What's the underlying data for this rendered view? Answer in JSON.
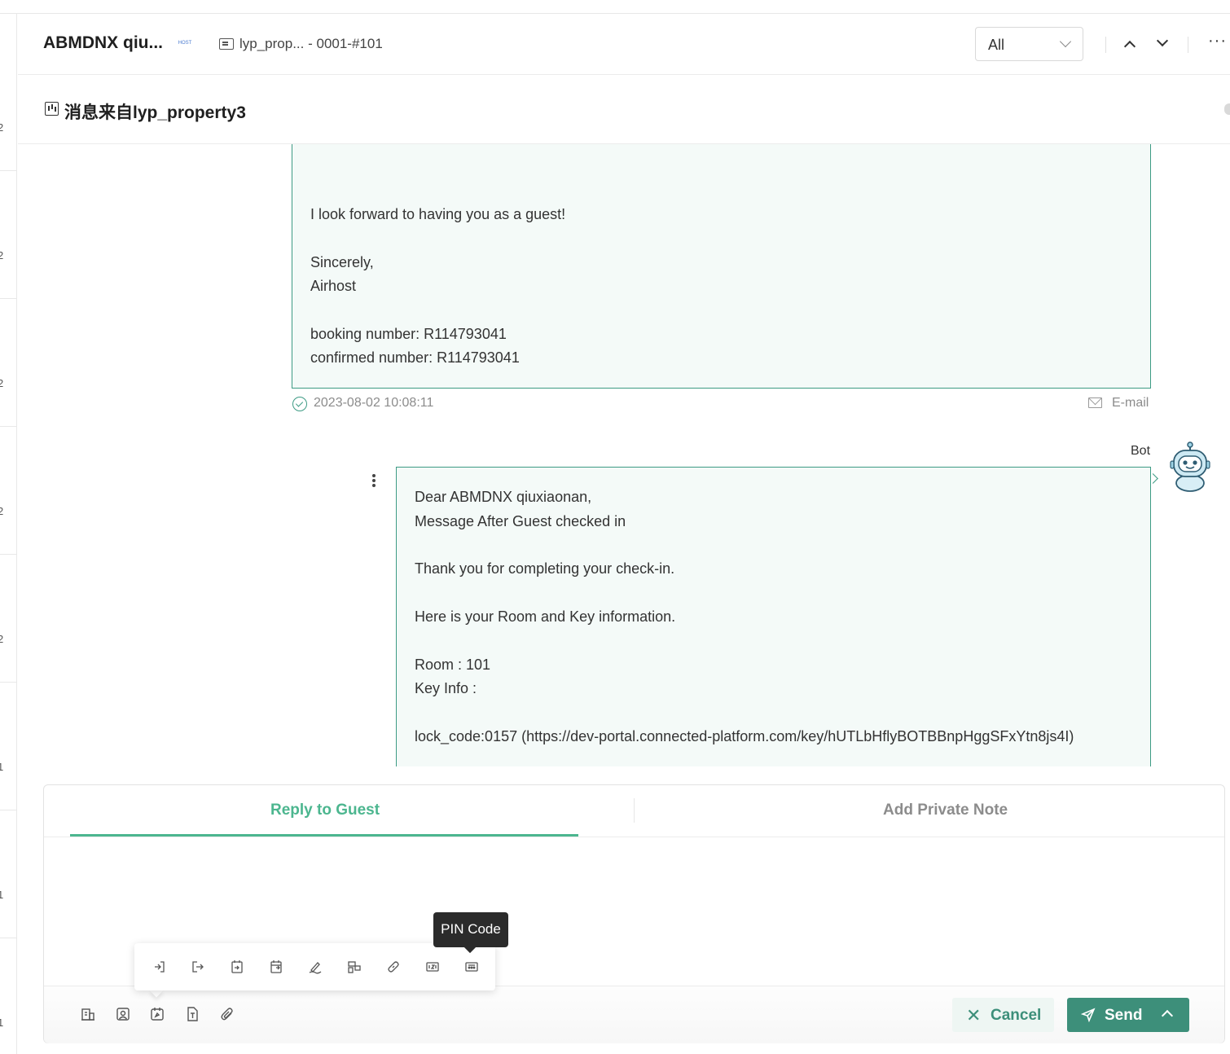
{
  "header": {
    "guest_name": "ABMDNX qiu...",
    "host_logo_text": "HOST",
    "property_label": "lyp_prop... - 0001-#101",
    "filter_select": "All",
    "more_label": "···"
  },
  "subheader": {
    "title": "消息来自lyp_property3"
  },
  "left_list": {
    "marks": [
      "2",
      "2",
      "2",
      "2",
      "2",
      "1",
      "1",
      "1"
    ]
  },
  "messages": [
    {
      "lines": [
        "I look forward to having you as a guest!",
        "Sincerely,",
        "Airhost",
        "booking number: R114793041",
        "confirmed number: R114793041"
      ],
      "timestamp": "2023-08-02 10:08:11",
      "channel": "E-mail"
    },
    {
      "sender": "Bot",
      "lines": [
        "Dear ABMDNX qiuxiaonan,",
        "Message After Guest checked in",
        "Thank you for completing your check-in.",
        "Here is your Room and Key information.",
        "Room : 101",
        "Key Info :",
        "lock_code:0157 (https://dev-portal.connected-platform.com/key/hUTLbHflyBOTBBnpHggSFxYtn8js4I)"
      ]
    }
  ],
  "composer": {
    "tab_reply": "Reply to Guest",
    "tab_note": "Add Private Note",
    "tooltip": "PIN Code",
    "cancel_label": "Cancel",
    "send_label": "Send",
    "toolbar_icons": [
      "property-icon",
      "guest-icon",
      "reservation-icon",
      "template-icon",
      "attachment-icon"
    ],
    "variable_icons": [
      "check-in-icon",
      "check-out-icon",
      "checkin-date-icon",
      "checkout-date-icon",
      "signature-icon",
      "room-type-icon",
      "link-icon",
      "room-number-icon",
      "pin-code-icon"
    ]
  },
  "colors": {
    "accent": "#4cb68f",
    "accent_dark": "#3d8f7a",
    "message_border": "#3d9b84",
    "message_bg": "#f4faf8"
  }
}
